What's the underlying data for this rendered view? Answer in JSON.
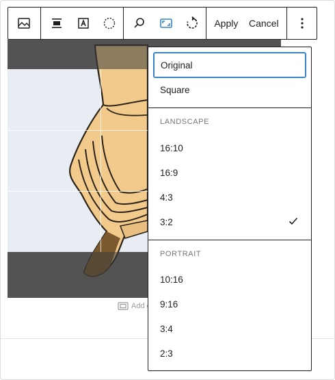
{
  "toolbar": {
    "buttons": {
      "block_type": "image-icon",
      "align": "align-center-icon",
      "text_overlay": "text-overlay-icon",
      "select": "select-circle-icon",
      "zoom": "zoom-icon",
      "aspect_ratio": "aspect-ratio-icon",
      "rotate": "rotate-icon",
      "more": "more-vertical-icon"
    },
    "apply_label": "Apply",
    "cancel_label": "Cancel"
  },
  "caption": {
    "placeholder": "Add c"
  },
  "aspect_menu": {
    "general": [
      {
        "label": "Original",
        "selected": true
      },
      {
        "label": "Square",
        "selected": false
      }
    ],
    "landscape_heading": "LANDSCAPE",
    "landscape": [
      {
        "label": "16:10"
      },
      {
        "label": "16:9"
      },
      {
        "label": "4:3"
      },
      {
        "label": "3:2",
        "checked": true
      }
    ],
    "portrait_heading": "PORTRAIT",
    "portrait": [
      {
        "label": "10:16"
      },
      {
        "label": "9:16"
      },
      {
        "label": "3:4"
      },
      {
        "label": "2:3"
      }
    ]
  },
  "colors": {
    "accent": "#3582c4",
    "border": "#1e1e1e",
    "muted_text": "#757575",
    "crop_overlay": "#6f6f6f",
    "image_fill": "#f5d49a"
  }
}
